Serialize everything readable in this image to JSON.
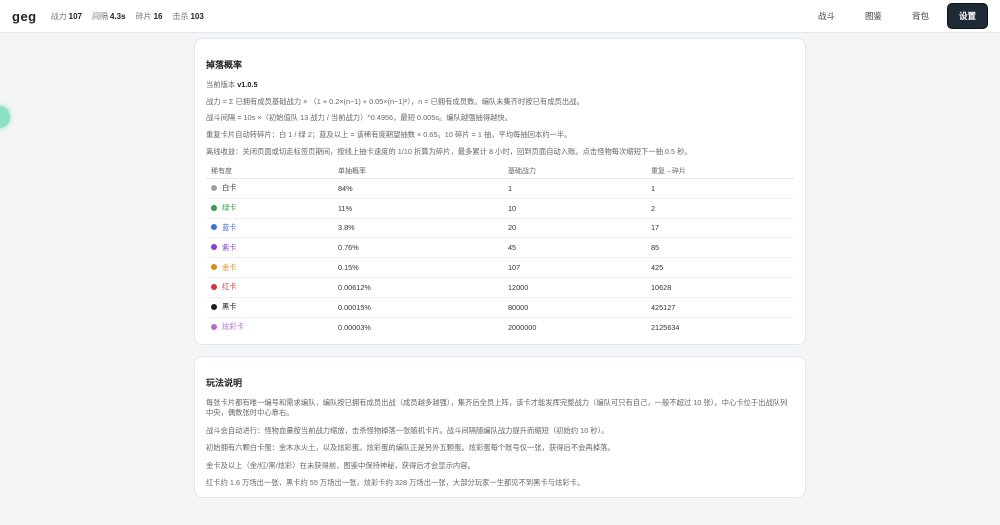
{
  "header": {
    "brand": "geg",
    "stats": [
      {
        "label": "战力",
        "value": "107"
      },
      {
        "label": "间隔",
        "value": "4.3s"
      },
      {
        "label": "碎片",
        "value": "16"
      },
      {
        "label": "击杀",
        "value": "103"
      }
    ],
    "nav": [
      {
        "label": "战斗"
      },
      {
        "label": "图鉴"
      },
      {
        "label": "背包"
      },
      {
        "label": "设置"
      }
    ]
  },
  "drop": {
    "title": "掉落概率",
    "version_prefix": "当前版本",
    "version": "v1.0.5",
    "lines": [
      "战力 = Σ 已拥有成员基础战力 × （1 + 0.2×(n−1) + 0.05×(n−1)²），n = 已拥有成员数。编队未集齐时按已有成员出战。",
      "战斗间隔 = 10s ×（初始值队 13 战力 / 当前战力）^0.4956，最短 0.005s。编队越强抽得越快。",
      "重复卡片自动转碎片：白 1 / 绿 2；蓝及以上 = 该稀有度期望抽数 × 0.65。10 碎片 = 1 抽，平均每抽回本约一半。",
      "离线收益：关闭页面或切走标签页期间，按线上抽卡速度的 1/10 折算为碎片，最多累计 8 小时，回到页面自动入账。点击怪物每次缩短下一抽 0.5 秒。"
    ],
    "table": {
      "headers": [
        "稀有度",
        "单抽概率",
        "基础战力",
        "重复→碎片"
      ],
      "rows": [
        {
          "name": "白卡",
          "color": "#9aa0a6",
          "prob": "84%",
          "power": "1",
          "shards": "1"
        },
        {
          "name": "绿卡",
          "color": "#2e9e4f",
          "prob": "11%",
          "power": "10",
          "shards": "2"
        },
        {
          "name": "蓝卡",
          "color": "#3b6fd8",
          "prob": "3.8%",
          "power": "20",
          "shards": "17"
        },
        {
          "name": "紫卡",
          "color": "#8a3fd1",
          "prob": "0.76%",
          "power": "45",
          "shards": "85"
        },
        {
          "name": "金卡",
          "color": "#e0891a",
          "prob": "0.15%",
          "power": "107",
          "shards": "425"
        },
        {
          "name": "红卡",
          "color": "#d63333",
          "prob": "0.00612%",
          "power": "12000",
          "shards": "10628"
        },
        {
          "name": "黑卡",
          "color": "#1b1b1b",
          "prob": "0.00015%",
          "power": "80000",
          "shards": "425127"
        },
        {
          "name": "炫彩卡",
          "color": "#b36bd6",
          "prob": "0.00003%",
          "power": "2000000",
          "shards": "2125634"
        }
      ]
    }
  },
  "guide": {
    "title": "玩法说明",
    "lines": [
      "每张卡片都有唯一编号和需求编队，编队按已拥有成员出战（成员越多越强），集齐后全员上阵，该卡才能发挥完整战力（编队可只有自己，一般不超过 10 张）。中心卡位于出战队列中央，偶数张时中心靠右。",
      "战斗会自动进行：怪物血量按当前战力缩放，击杀怪物掉落一张随机卡片。战斗间隔随编队战力提升而缩短（初始约 10 秒）。",
      "初始拥有六颗白卡蛋：金木水火土，以及炫彩蛋。炫彩蛋的编队正是另外五颗蛋。炫彩蛋每个账号仅一张，获得后不会再掉落。",
      "金卡及以上（金/红/黑/炫彩）在未获得前，图鉴中保持神秘，获得后才会显示内容。",
      "红卡约 1.6 万场出一张，黑卡约 55 万场出一张，炫彩卡约 328 万场出一张，大部分玩家一生都见不到黑卡与炫彩卡。"
    ]
  }
}
